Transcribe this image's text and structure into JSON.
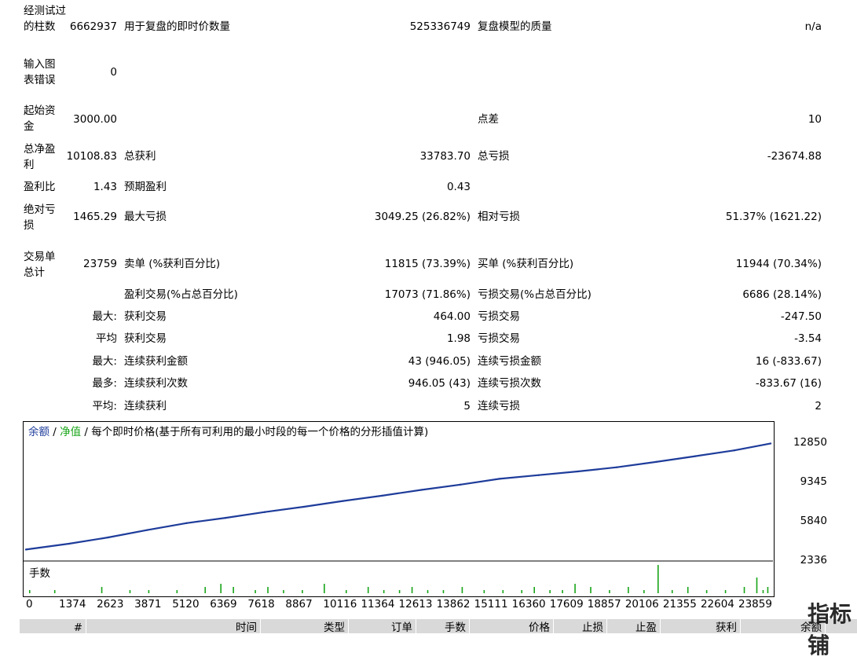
{
  "report": {
    "r1": {
      "label": "经测试过的柱数",
      "value": "6662937",
      "label2": "用于复盘的即时价数量",
      "value2": "525336749",
      "label3": "复盘模型的质量",
      "value3": "n/a"
    },
    "r2": {
      "label": "输入图表错误",
      "value": "0"
    },
    "r3": {
      "label": "起始资金",
      "value": "3000.00",
      "label3": "点差",
      "value3": "10"
    },
    "r4": {
      "label": "总净盈利",
      "value": "10108.83",
      "label2": "总获利",
      "value2": "33783.70",
      "label3": "总亏损",
      "value3": "-23674.88"
    },
    "r5": {
      "label": "盈利比",
      "value": "1.43",
      "label2": "预期盈利",
      "value2": "0.43"
    },
    "r6": {
      "label": "绝对亏损",
      "value": "1465.29",
      "label2": "最大亏损",
      "value2": "3049.25 (26.82%)",
      "label3": "相对亏损",
      "value3": "51.37% (1621.22)"
    },
    "r7": {
      "label": "交易单总计",
      "value": "23759",
      "label2": "卖单 (%获利百分比)",
      "value2": "11815 (73.39%)",
      "label3": "买单 (%获利百分比)",
      "value3": "11944 (70.34%)"
    },
    "r8": {
      "label2": "盈利交易(%占总百分比)",
      "value2": "17073 (71.86%)",
      "label3": "亏损交易(%占总百分比)",
      "value3": "6686 (28.14%)"
    },
    "r9": {
      "value": "最大:",
      "label2": "获利交易",
      "value2": "464.00",
      "label3": "亏损交易",
      "value3": "-247.50"
    },
    "r10": {
      "value": "平均",
      "label2": "获利交易",
      "value2": "1.98",
      "label3": "亏损交易",
      "value3": "-3.54"
    },
    "r11": {
      "value": "最大:",
      "label2": "连续获利金额",
      "value2": "43 (946.05)",
      "label3": "连续亏损金额",
      "value3": "16 (-833.67)"
    },
    "r12": {
      "value": "最多:",
      "label2": "连续获利次数",
      "value2": "946.05 (43)",
      "label3": "连续亏损次数",
      "value3": "-833.67 (16)"
    },
    "r13": {
      "value": "平均:",
      "label2": "连续获利",
      "value2": "5",
      "label3": "连续亏损",
      "value3": "2"
    }
  },
  "chart_title": {
    "balance": "余额",
    "sep": " / ",
    "equity": "净值",
    "rest": " / 每个即时价格(基于所有可利用的最小时段的每一个价格的分形插值计算)"
  },
  "lots_label": "手数",
  "chart_data": {
    "type": "line",
    "x": [
      0,
      1374,
      2623,
      3871,
      5120,
      6369,
      7618,
      8867,
      10116,
      11364,
      12613,
      13862,
      15111,
      16360,
      17609,
      18857,
      20106,
      21355,
      22604,
      23759
    ],
    "series": [
      {
        "name": "余额",
        "color": "#1e3c9a",
        "values": [
          2900,
          3450,
          4050,
          4750,
          5400,
          5900,
          6450,
          6950,
          7500,
          8000,
          8550,
          9050,
          9600,
          9950,
          10300,
          10700,
          11200,
          11750,
          12300,
          12950
        ]
      }
    ],
    "yticks": [
      2336,
      5840,
      9345,
      12850
    ],
    "xticks": [
      "0",
      "1374",
      "2623",
      "3871",
      "5120",
      "6369",
      "7618",
      "8867",
      "10116",
      "11364",
      "12613",
      "13862",
      "15111",
      "16360",
      "17609",
      "18857",
      "20106",
      "21355",
      "22604",
      "23859"
    ],
    "ylim": [
      2336,
      14100
    ],
    "grid": false
  },
  "lots_data": {
    "color": "#18a418",
    "x": [
      100,
      900,
      2400,
      3300,
      3900,
      4800,
      5700,
      6200,
      6600,
      7300,
      7700,
      8200,
      8800,
      9500,
      10200,
      10900,
      11400,
      11900,
      12300,
      12800,
      13300,
      13900,
      14600,
      15200,
      15800,
      16200,
      16700,
      17100,
      17500,
      18000,
      18600,
      19200,
      19700,
      20150,
      20600,
      21100,
      21700,
      22300,
      22900,
      23300,
      23500,
      23650
    ],
    "values": [
      1,
      1,
      2,
      1,
      1,
      1,
      2,
      3,
      2,
      1,
      2,
      1,
      1,
      3,
      1,
      2,
      1,
      1,
      2,
      1,
      1,
      2,
      1,
      1,
      1,
      2,
      1,
      1,
      3,
      2,
      1,
      2,
      1,
      9,
      1,
      2,
      1,
      1,
      2,
      5,
      1,
      2
    ]
  },
  "table_header": [
    "#",
    "时间",
    "类型",
    "订单",
    "手数",
    "价格",
    "止损",
    "止盈",
    "获利",
    "余额"
  ],
  "watermark": "指标铺"
}
